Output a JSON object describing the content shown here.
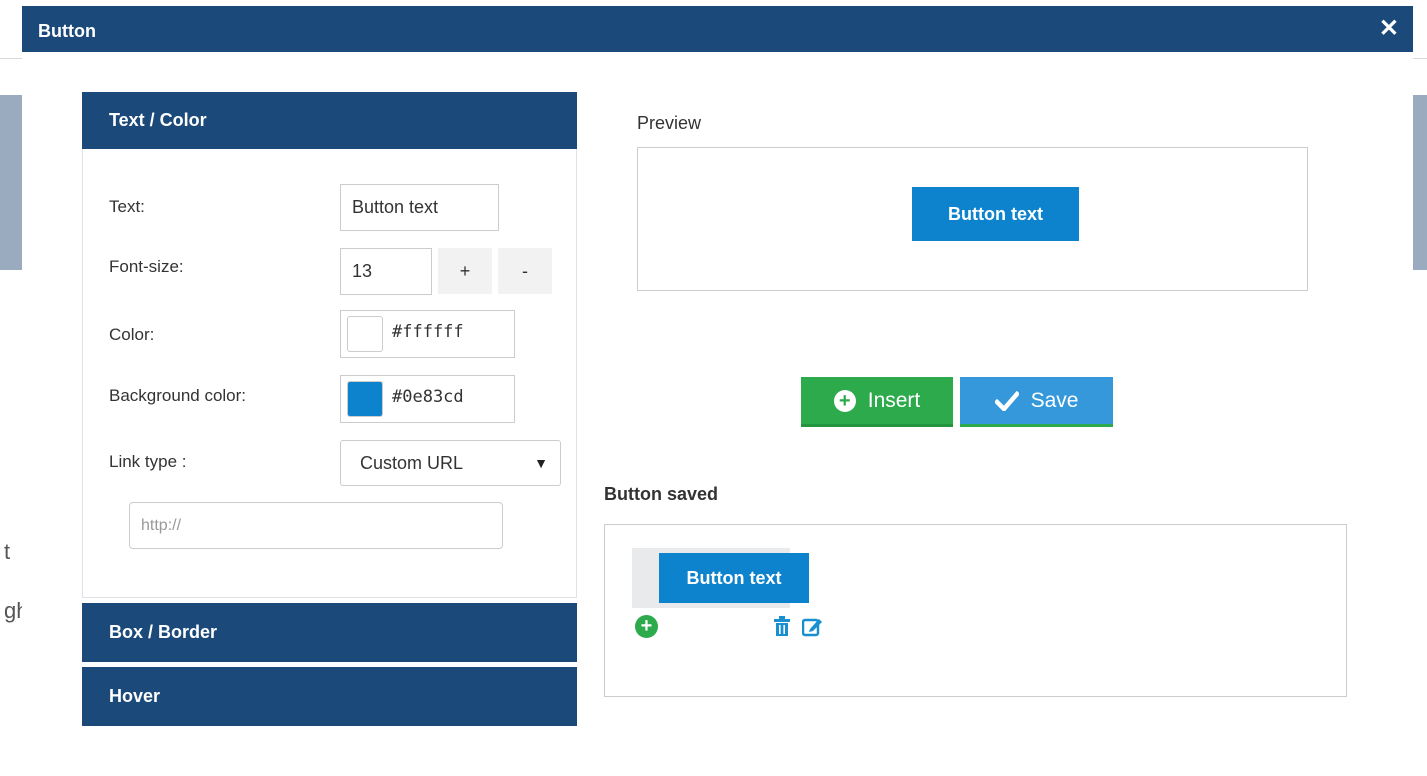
{
  "background": {
    "fragment_1": "t",
    "fragment_2": "gh"
  },
  "modal": {
    "title": "Button",
    "close_glyph": "✕"
  },
  "accordion": {
    "text_color": {
      "title": "Text / Color"
    },
    "box_border": {
      "title": "Box / Border"
    },
    "hover": {
      "title": "Hover"
    }
  },
  "form": {
    "text_label": "Text:",
    "text_value": "Button text",
    "font_size_label": "Font-size:",
    "font_size_value": "13",
    "increase_label": "+",
    "decrease_label": "-",
    "color_label": "Color:",
    "color_value": "#ffffff",
    "bg_color_label": "Background color:",
    "bg_color_value": "#0e83cd",
    "link_type_label": "Link type :",
    "link_type_value": "Custom URL",
    "url_placeholder": "http://"
  },
  "preview": {
    "label": "Preview",
    "button_text": "Button text"
  },
  "actions": {
    "insert_label": "Insert",
    "save_label": "Save"
  },
  "saved": {
    "label": "Button saved",
    "button_text": "Button text"
  },
  "colors": {
    "header": "#1b4a7a",
    "button_bg": "#0e83cd",
    "insert_green": "#2daa4c",
    "save_blue": "#3498db"
  },
  "icons": {
    "close": "close-icon",
    "plus": "plus-circle-icon",
    "check": "check-icon",
    "trash": "trash-icon",
    "edit": "edit-icon",
    "caret": "caret-down-icon"
  }
}
